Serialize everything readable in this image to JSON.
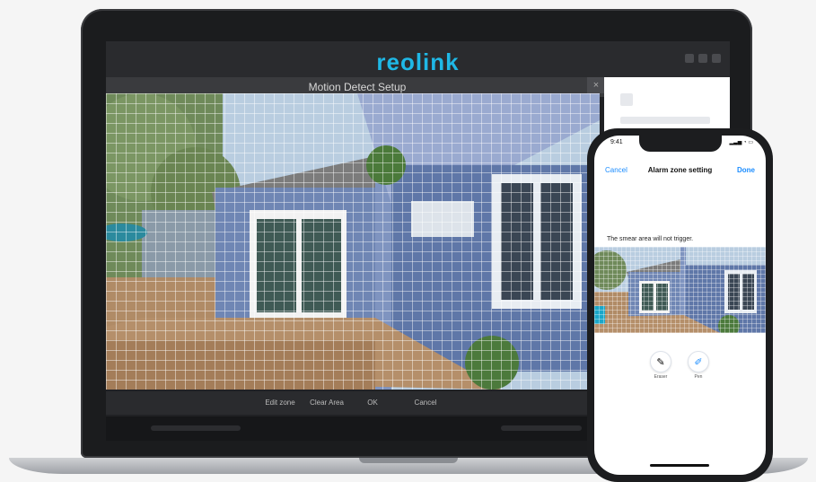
{
  "app": {
    "brand": "reolink",
    "window_title": "Motion Detect Setup",
    "close_glyph": "×"
  },
  "toolbar": {
    "buttons": [
      "Edit zone",
      "Clear Area",
      "OK",
      "Cancel"
    ]
  },
  "phone": {
    "status_time": "9:41",
    "status_icons": "▂▃▅ ◔ ▭",
    "nav": {
      "cancel": "Cancel",
      "title": "Alarm zone setting",
      "done": "Done"
    },
    "hint": "The smear area will not trigger.",
    "tools": [
      {
        "icon": "eraser-icon",
        "glyph": "✎",
        "label": "Eraser"
      },
      {
        "icon": "pen-icon",
        "glyph": "✐",
        "label": "Pen"
      }
    ]
  },
  "colors": {
    "brand": "#1fb8e6",
    "ios_link": "#1a8cff",
    "house_siding": "#6f86b4",
    "deck": "#b58f6a"
  }
}
